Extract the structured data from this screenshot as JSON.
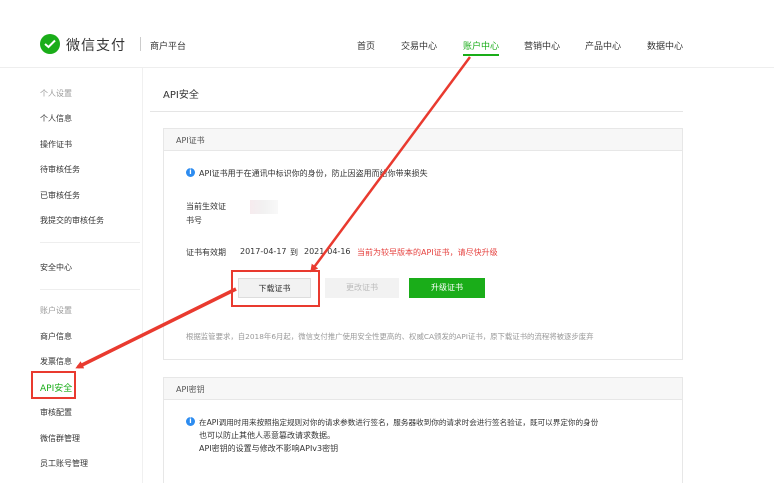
{
  "header": {
    "brand": "微信支付",
    "merchant": "商户平台",
    "nav": [
      {
        "label": "首页"
      },
      {
        "label": "交易中心"
      },
      {
        "label": "账户中心"
      },
      {
        "label": "营销中心"
      },
      {
        "label": "产品中心"
      },
      {
        "label": "数据中心"
      }
    ],
    "active_nav": "账户中心"
  },
  "sidebar": {
    "personal_head": "个人设置",
    "personal_items": [
      "个人信息",
      "操作证书",
      "待审核任务",
      "已审核任务",
      "我提交的审核任务"
    ],
    "security": "安全中心",
    "account_head": "账户设置",
    "account_items": [
      "商户信息",
      "发票信息",
      "API安全",
      "审核配置",
      "微信群管理",
      "员工账号管理"
    ],
    "active_item": "API安全"
  },
  "main": {
    "title": "API安全",
    "cert": {
      "head": "API证书",
      "info": "API证书用于在通讯中标识你的身份，防止因盗用而给你带来损失",
      "current_label_1": "当前生效证",
      "current_label_2": "书号",
      "validity_label": "证书有效期",
      "start_date": "2017-04-17",
      "to": "到",
      "end_date": "2021-04-16",
      "warning": "当前为较早版本的API证书，请尽快升级",
      "download_btn": "下载证书",
      "change_btn": "更改证书",
      "upgrade_btn": "升级证书",
      "notice": "根据监管要求，自2018年6月起，微信支付推广使用安全性更高的、权威CA颁发的API证书，原下载证书的流程将被逐步废弃"
    },
    "key": {
      "head": "API密钥",
      "line1": "在API调用时用来按照指定规则对你的请求参数进行签名，服务器收到你的请求时会进行签名验证，既可以界定你的身份",
      "line2": "也可以防止其他人恶意篡改请求数据。",
      "line3": "API密钥的设置与修改不影响APIv3密钥"
    }
  },
  "colors": {
    "accent": "#1aad19",
    "annotation": "#e93a2f",
    "warning": "#e64340",
    "info": "#2d8cf0"
  }
}
